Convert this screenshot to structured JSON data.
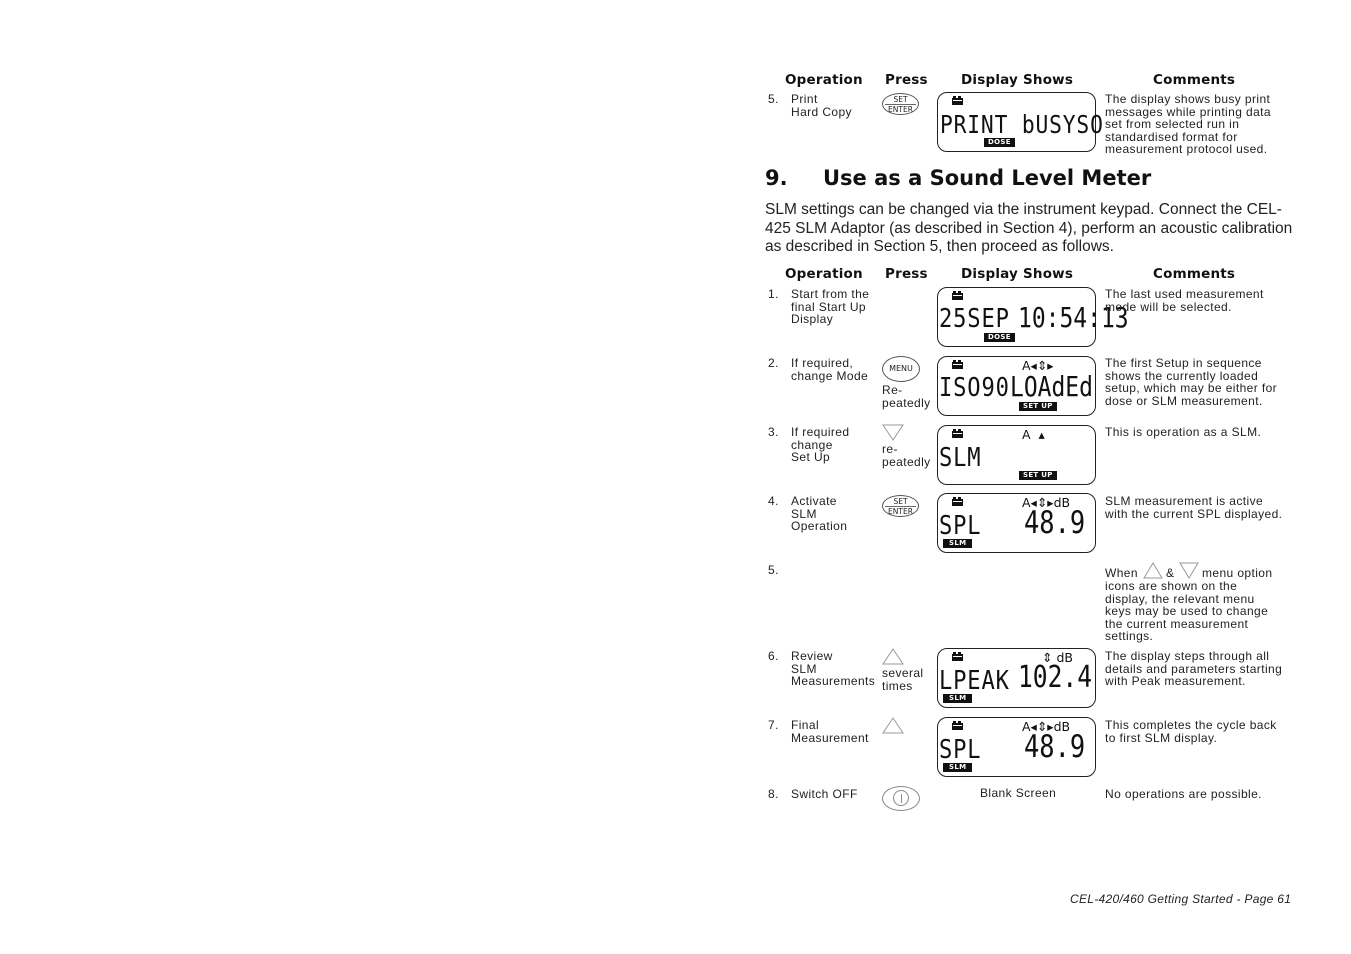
{
  "table1": {
    "headers": {
      "operation": "Operation",
      "press": "Press",
      "display": "Display Shows",
      "comments": "Comments"
    },
    "rows": [
      {
        "num": "5.",
        "operation": [
          "Print",
          "Hard Copy"
        ],
        "press_key": {
          "icon": "set-enter-key",
          "line1": "SET",
          "line2": "ENTER"
        },
        "display": {
          "main": "PRINT bUSYSO",
          "tag": "DOSE"
        },
        "comment": [
          "The display shows busy print",
          "messages while printing data",
          "set from selected run in",
          "standardised format for",
          "measurement protocol used."
        ]
      }
    ]
  },
  "section": {
    "number": "9.",
    "title": "Use as a Sound Level Meter",
    "intro": "SLM settings can be changed via the instrument keypad. Connect the CEL-425 SLM Adaptor (as described in Section 4), perform an acoustic calibration as described in Section 5, then proceed as follows."
  },
  "table2": {
    "headers": {
      "operation": "Operation",
      "press": "Press",
      "display": "Display Shows",
      "comments": "Comments"
    },
    "rows": [
      {
        "num": "1.",
        "operation": [
          "Start from the",
          "final Start Up",
          "Display"
        ],
        "display": {
          "main": "25SEP",
          "value": "10:54:13",
          "tag": "DOSE"
        },
        "comment": [
          "The last used measurement",
          "mode will be selected."
        ]
      },
      {
        "num": "2.",
        "operation": [
          "If required,",
          "change Mode"
        ],
        "press_key": {
          "icon": "menu-key",
          "label": "MENU",
          "note": [
            "Re-",
            "peatedly"
          ]
        },
        "display": {
          "main": "ISO90",
          "value": "LOAdEd",
          "indicators": "A◂⇕▸",
          "tag": "SET UP"
        },
        "comment": [
          "The first Setup in sequence",
          "shows the currently loaded",
          "setup, which may be either for",
          "dose or SLM measurement."
        ]
      },
      {
        "num": "3.",
        "operation": [
          "If required",
          "change",
          "Set Up"
        ],
        "press_key": {
          "icon": "down-arrow-key",
          "note": [
            "re-",
            "peatedly"
          ]
        },
        "display": {
          "main": "SLM",
          "indicators": "A  ▴",
          "tag": "SET UP"
        },
        "comment": [
          "This is operation as a SLM."
        ]
      },
      {
        "num": "4.",
        "operation": [
          "Activate",
          "SLM",
          "Operation"
        ],
        "press_key": {
          "icon": "set-enter-key",
          "line1": "SET",
          "line2": "ENTER"
        },
        "display": {
          "main": "SPL",
          "value": "48.9",
          "indicators": "A◂⇕▸dB",
          "tag": "SLM"
        },
        "comment": [
          "SLM measurement is active",
          "with the current SPL displayed."
        ]
      },
      {
        "num": "5.",
        "operation": [],
        "comment_prefix": "When",
        "comment_mid": "&",
        "comment_suffix": "menu option",
        "comment": [
          "icons are shown on the",
          "display, the relevant menu",
          "keys may be used to change",
          "the current measurement",
          "settings."
        ]
      },
      {
        "num": "6.",
        "operation": [
          "Review",
          "SLM",
          "Measurements"
        ],
        "press_key": {
          "icon": "up-arrow-key",
          "note": [
            "several",
            "times"
          ]
        },
        "display": {
          "main": "LPEAK",
          "value": "102.4",
          "indicators": "⇕ dB",
          "tag": "SLM"
        },
        "comment": [
          "The display steps through all",
          "details and parameters starting",
          "with Peak measurement."
        ]
      },
      {
        "num": "7.",
        "operation": [
          "Final",
          "Measurement"
        ],
        "press_key": {
          "icon": "up-arrow-key"
        },
        "display": {
          "main": "SPL",
          "value": "48.9",
          "indicators": "A◂⇕▸dB",
          "tag": "SLM"
        },
        "comment": [
          "This completes the cycle back",
          "to first SLM display."
        ]
      },
      {
        "num": "8.",
        "operation": [
          "Switch OFF"
        ],
        "press_key": {
          "icon": "power-key"
        },
        "display_text": "Blank Screen",
        "comment": [
          "No operations are possible."
        ]
      }
    ]
  },
  "footer": "CEL-420/460 Getting Started - Page 61"
}
